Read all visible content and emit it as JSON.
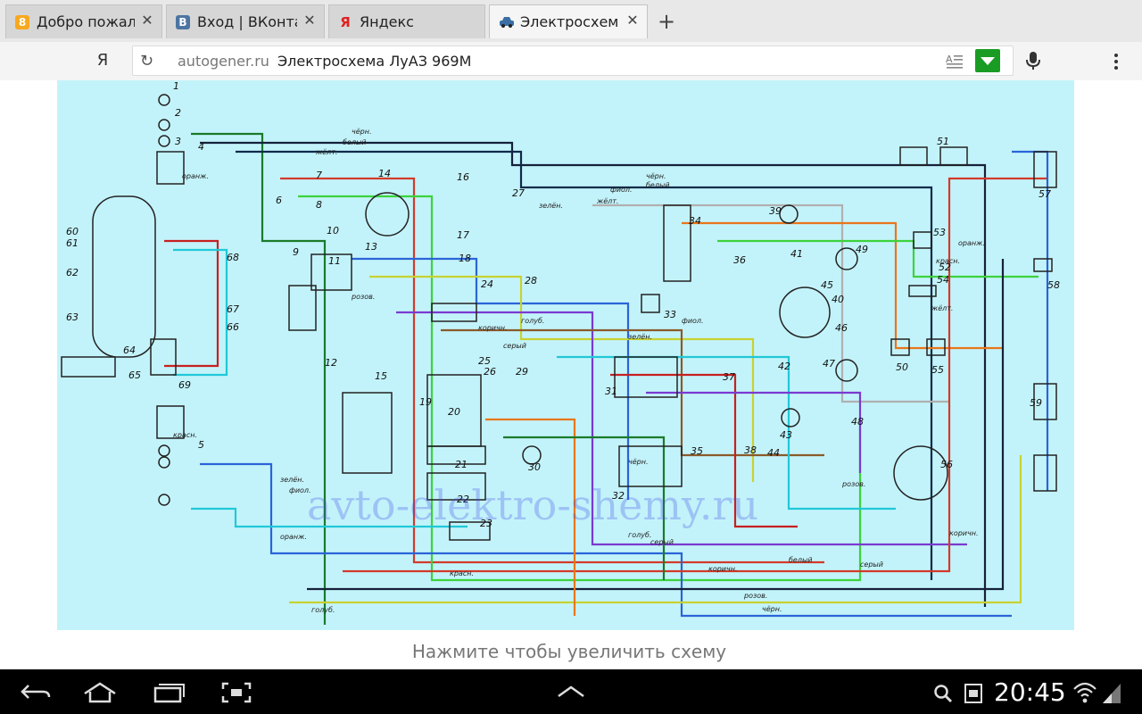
{
  "tabs": [
    {
      "title": "Добро пожал",
      "favicon": "yandex-zen-icon",
      "favicon_color": "#f8a81e",
      "favicon_glyph": "8"
    },
    {
      "title": "Вход | ВКонта",
      "favicon": "vk-icon",
      "favicon_color": "#4c75a3",
      "favicon_glyph": "В"
    },
    {
      "title": "Яндекс",
      "favicon": "yandex-icon",
      "favicon_color": "#ffffff",
      "favicon_glyph": "Я"
    },
    {
      "title": "Электросхем",
      "favicon": "car-icon",
      "favicon_color": "#3a6ea5",
      "favicon_glyph": ""
    }
  ],
  "toolbar": {
    "ya_button": "Я",
    "url_domain": "autogener.ru",
    "url_title": "Электросхема ЛуАЗ 969М"
  },
  "diagram": {
    "watermark": "avto-elektro-shemy.ru",
    "wire_labels": [
      "чёрн.",
      "белый",
      "жёлт.",
      "зелён.",
      "фиол.",
      "красн.",
      "оранж.",
      "голуб.",
      "серый",
      "коричн.",
      "розов."
    ],
    "component_numbers": [
      "1",
      "2",
      "3",
      "4",
      "5",
      "6",
      "7",
      "8",
      "9",
      "10",
      "11",
      "12",
      "13",
      "14",
      "15",
      "16",
      "17",
      "18",
      "19",
      "20",
      "21",
      "22",
      "23",
      "24",
      "25",
      "26",
      "27",
      "28",
      "29",
      "30",
      "31",
      "32",
      "33",
      "34",
      "35",
      "36",
      "37",
      "38",
      "39",
      "40",
      "41",
      "42",
      "43",
      "44",
      "45",
      "46",
      "47",
      "48",
      "49",
      "50",
      "51",
      "52",
      "53",
      "54",
      "55",
      "56",
      "57",
      "58",
      "59",
      "60",
      "61",
      "62",
      "63",
      "64",
      "65",
      "66",
      "67",
      "68",
      "69"
    ]
  },
  "caption": "Нажмите чтобы увеличить схему",
  "status": {
    "time": "20:45"
  }
}
